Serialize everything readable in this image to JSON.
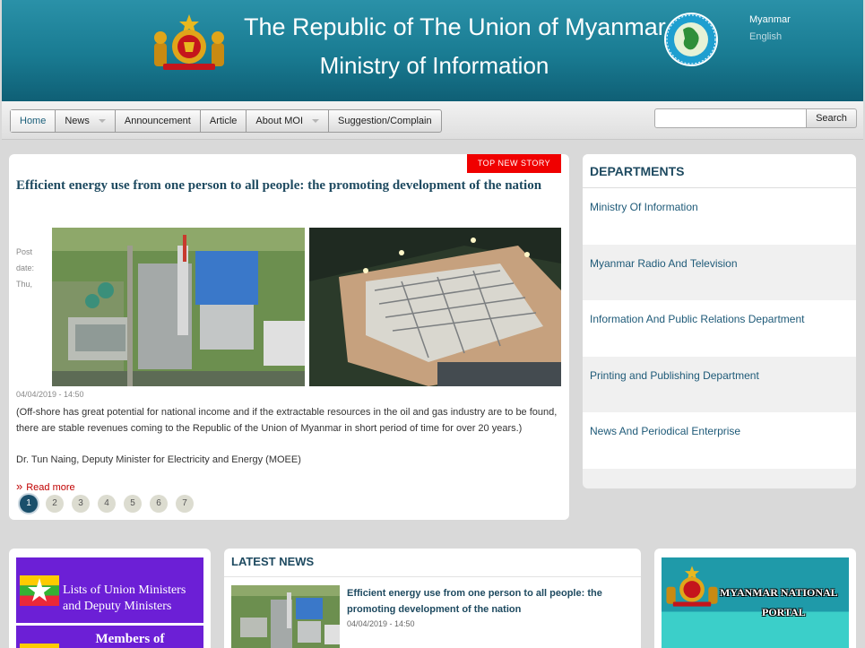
{
  "header": {
    "title_line1": "The Republic of The Union of Myanmar",
    "title_line2": "Ministry of Information",
    "languages": [
      "Myanmar",
      "English"
    ]
  },
  "nav": {
    "items": [
      {
        "label": "Home",
        "active": true,
        "has_dropdown": false
      },
      {
        "label": "News",
        "active": false,
        "has_dropdown": true
      },
      {
        "label": "Announcement",
        "active": false,
        "has_dropdown": false
      },
      {
        "label": "Article",
        "active": false,
        "has_dropdown": false
      },
      {
        "label": "About MOI",
        "active": false,
        "has_dropdown": true
      },
      {
        "label": "Suggestion/Complain",
        "active": false,
        "has_dropdown": false
      }
    ],
    "search_value": "",
    "search_button": "Search"
  },
  "story": {
    "badge": "TOP NEW STORY",
    "title": "Efficient energy use from one person to all people: the promoting development of the nation",
    "post_label": "Post date: Thu,",
    "date": "04/04/2019 - 14:50",
    "summary": "(Off-shore has great potential for national income and if the extractable resources in the oil and gas industry are to be found, there are stable revenues coming to the Republic of the Union of Myanmar in short period of time for over 20 years.)",
    "author": "Dr. Tun Naing, Deputy Minister for Electricity and Energy (MOEE)",
    "read_more": "Read more",
    "pages": [
      "1",
      "2",
      "3",
      "4",
      "5",
      "6",
      "7"
    ],
    "current_page": "1"
  },
  "departments": {
    "heading": "DEPARTMENTS",
    "items": [
      "Ministry Of Information",
      "Myanmar Radio And Television",
      "Information And Public Relations Department",
      "Printing and Publishing Department",
      "News And Periodical Enterprise"
    ]
  },
  "links": {
    "ministers": "Lists of Union Ministers and Deputy Ministers",
    "members": "Members of"
  },
  "latest_news": {
    "heading": "LATEST NEWS",
    "title": "Efficient energy use from one person to all people: the promoting development of the nation",
    "date": "04/04/2019 - 14:50"
  },
  "portal": {
    "line1": "MYANMAR NATIONAL",
    "line2": "PORTAL"
  },
  "colors": {
    "header": "#197b92",
    "accent_red": "#f00000",
    "title_blue": "#1e4a60",
    "banner_purple": "#6c1fd6",
    "portal_teal": "#1f9aa9"
  },
  "icons": {
    "emblem": "state-emblem-icon",
    "seal": "ministry-seal-icon",
    "flag": "myanmar-flag-icon",
    "caret": "caret-down-icon",
    "read_more": "double-chevron-right-icon"
  }
}
